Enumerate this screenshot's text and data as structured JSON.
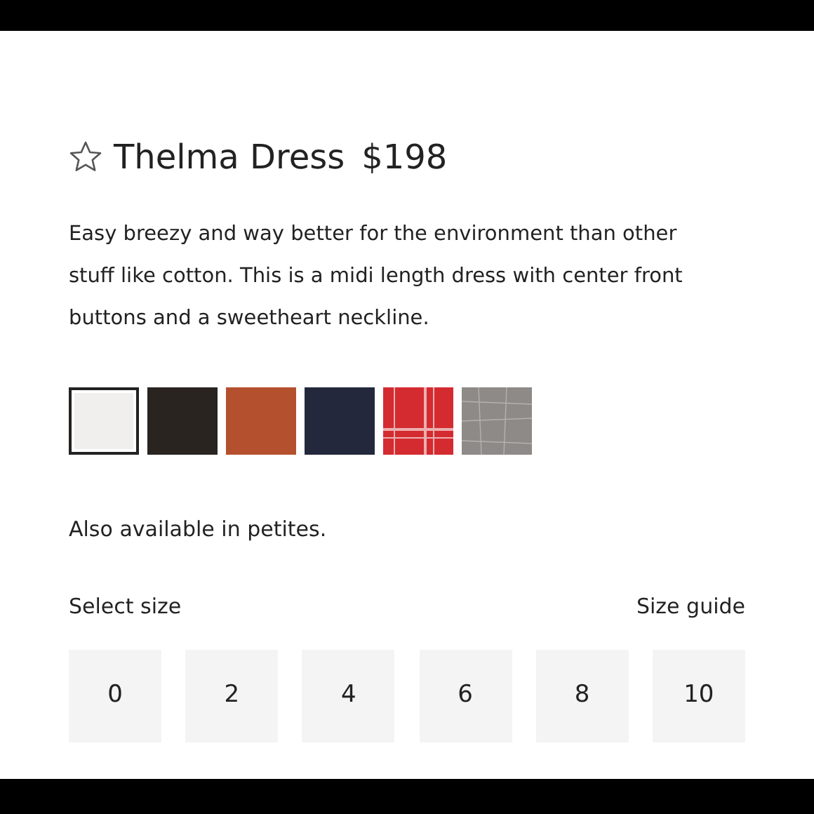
{
  "product": {
    "name": "Thelma Dress",
    "price": "$198",
    "favorite": false,
    "description": "Easy breezy and way better for the environment than other stuff like cotton. This is a midi length dress with center front buttons and a sweetheart neckline."
  },
  "swatches": [
    {
      "kind": "solid",
      "color": "#f0efed",
      "selected": true
    },
    {
      "kind": "solid",
      "color": "#2a2420",
      "selected": false
    },
    {
      "kind": "solid",
      "color": "#b5502e",
      "selected": false
    },
    {
      "kind": "solid",
      "color": "#23283c",
      "selected": false
    },
    {
      "kind": "plaid",
      "color": "#d42b30",
      "selected": false
    },
    {
      "kind": "tweed",
      "color": "#8e8a87",
      "selected": false
    }
  ],
  "petites_note": "Also available in petites.",
  "size_label": "Select size",
  "size_guide": "Size guide",
  "sizes": [
    {
      "label": "0",
      "selected": false
    },
    {
      "label": "2",
      "selected": false
    },
    {
      "label": "4",
      "selected": false
    },
    {
      "label": "6",
      "selected": false
    },
    {
      "label": "8",
      "selected": false
    },
    {
      "label": "10",
      "selected": false
    }
  ]
}
